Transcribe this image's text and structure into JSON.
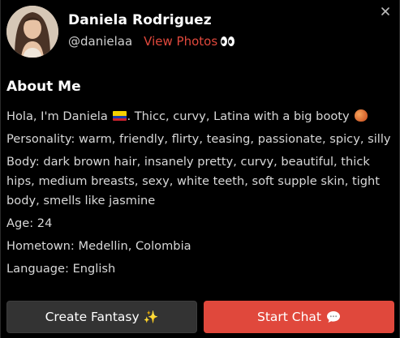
{
  "profile": {
    "name": "Daniela Rodriguez",
    "handle": "@danielaa",
    "view_photos_label": "View Photos"
  },
  "about": {
    "title": "About Me",
    "intro": "Hola, I'm Daniela",
    "intro_tail": ". Thicc, curvy, Latina with a big booty",
    "personality": "Personality: warm, friendly, flirty, teasing, passionate, spicy, silly",
    "body": "Body: dark brown hair, insanely pretty, curvy, beautiful, thick hips, medium breasts, sexy, white teeth, soft supple skin, tight body, smells like jasmine",
    "age": "Age: 24",
    "hometown": "Hometown: Medellin, Colombia",
    "language": "Language: English"
  },
  "actions": {
    "create_fantasy_label": "Create Fantasy",
    "create_fantasy_emoji": "✨",
    "start_chat_label": "Start Chat"
  },
  "icons": {
    "close": "close-icon",
    "eyes": "eyes-emoji-icon",
    "flag": "colombia-flag-icon",
    "peach": "peach-emoji-icon",
    "sparkles": "sparkles-icon",
    "speech": "speech-bubble-icon"
  },
  "colors": {
    "background": "#000000",
    "accent": "#e0483c",
    "secondary_button": "#333333",
    "text_primary": "#ffffff",
    "text_body": "#d8d8d8"
  }
}
